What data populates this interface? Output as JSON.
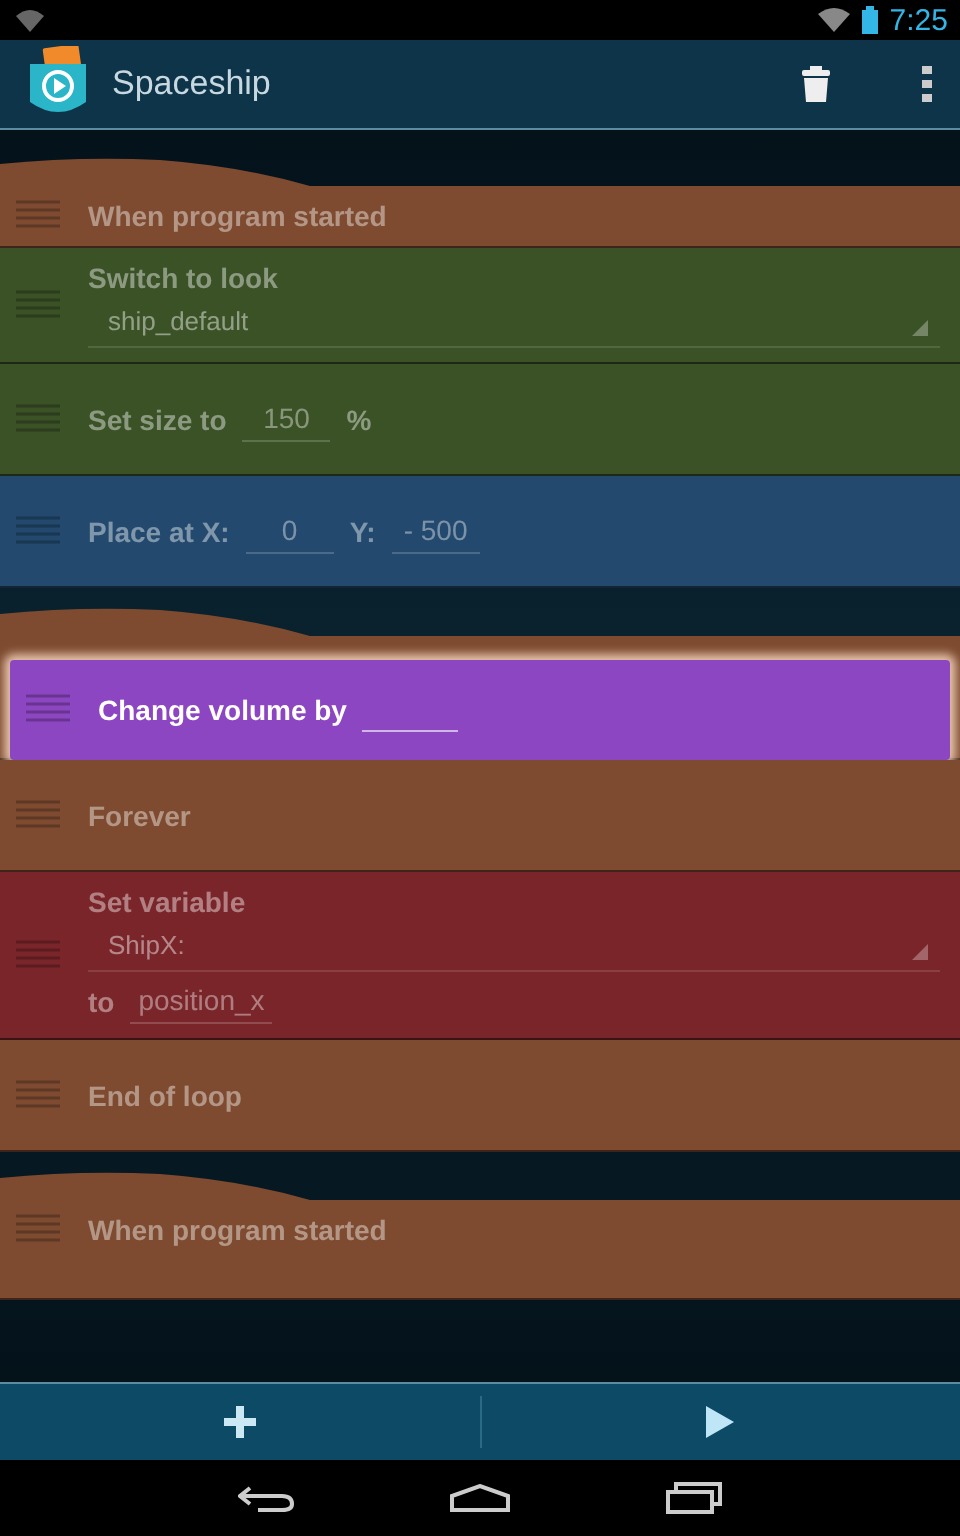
{
  "status_bar": {
    "time": "7:25"
  },
  "action_bar": {
    "title": "Spaceship"
  },
  "bricks": [
    {
      "kind": "hat",
      "color": "#7e4b30",
      "dragging": false,
      "lines": [
        [
          {
            "kind": "label",
            "text": "When program started"
          }
        ]
      ]
    },
    {
      "kind": "plain",
      "color": "#3a5226",
      "dragging": false,
      "lines": [
        [
          {
            "kind": "label",
            "text": "Switch to look"
          }
        ],
        [
          {
            "kind": "dropdown",
            "value": "ship_default"
          }
        ]
      ]
    },
    {
      "kind": "plain",
      "color": "#3a5226",
      "dragging": false,
      "lines": [
        [
          {
            "kind": "label",
            "text": "Set size to"
          },
          {
            "kind": "field",
            "value": "150"
          },
          {
            "kind": "label",
            "text": "%"
          }
        ]
      ]
    },
    {
      "kind": "plain",
      "color": "#234a6e",
      "dragging": false,
      "lines": [
        [
          {
            "kind": "label",
            "text": "Place at X:"
          },
          {
            "kind": "field",
            "value": "0"
          },
          {
            "kind": "label",
            "text": "Y:"
          },
          {
            "kind": "field",
            "value": "- 500"
          }
        ]
      ]
    },
    {
      "kind": "hat",
      "color": "#7e4b30",
      "dragging": false
    },
    {
      "kind": "plain",
      "color": "#8c46c2",
      "dragging": true,
      "lines": [
        [
          {
            "kind": "label",
            "text": "Change volume by"
          },
          {
            "kind": "field"
          }
        ]
      ]
    },
    {
      "kind": "plain",
      "color": "#7e4b30",
      "dragging": false,
      "lines": [
        [
          {
            "kind": "label",
            "text": "Forever"
          }
        ]
      ]
    },
    {
      "kind": "plain",
      "color": "#7a252a",
      "dragging": false,
      "lines": [
        [
          {
            "kind": "label",
            "text": "Set variable"
          }
        ],
        [
          {
            "kind": "dropdown",
            "value": "ShipX:"
          }
        ],
        [
          {
            "kind": "label",
            "text": "to"
          },
          {
            "kind": "field",
            "value": "position_x"
          }
        ]
      ]
    },
    {
      "kind": "plain",
      "color": "#7e4b30",
      "dragging": false,
      "lines": [
        [
          {
            "kind": "label",
            "text": "End of loop"
          }
        ]
      ]
    },
    {
      "kind": "hat",
      "color": "#7e4b30",
      "dragging": false,
      "lines": [
        [
          {
            "kind": "label",
            "text": "When program started"
          }
        ]
      ]
    }
  ]
}
